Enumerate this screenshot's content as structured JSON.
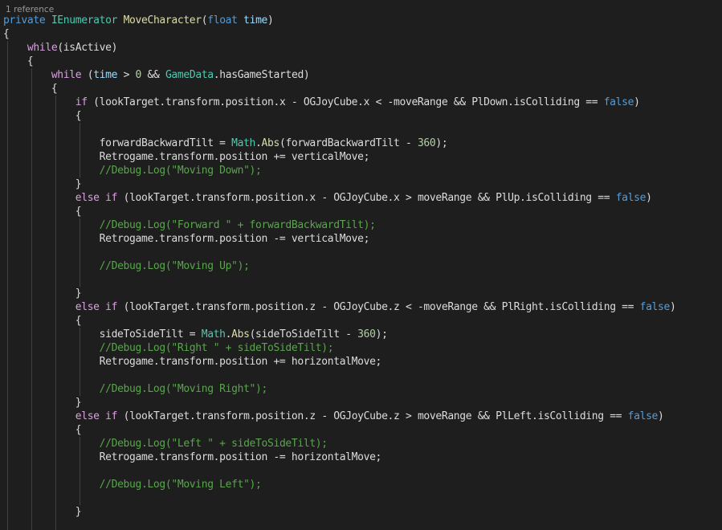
{
  "codelens": {
    "references": "1 reference"
  },
  "colors": {
    "background": "#1e1e1e",
    "keyword": "#569cd6",
    "control": "#d8a0df",
    "type": "#4ec9b0",
    "method": "#dcdcaa",
    "comment": "#57a64a",
    "number": "#b5cea8",
    "plain": "#dcdcdc",
    "parameter": "#9cdcfe"
  },
  "lines": [
    [
      {
        "c": "kw",
        "t": "private"
      },
      {
        "c": "id",
        "t": " "
      },
      {
        "c": "ty",
        "t": "IEnumerator"
      },
      {
        "c": "id",
        "t": " "
      },
      {
        "c": "mth",
        "t": "MoveCharacter"
      },
      {
        "c": "id",
        "t": "("
      },
      {
        "c": "kw",
        "t": "float"
      },
      {
        "c": "id",
        "t": " "
      },
      {
        "c": "pr",
        "t": "time"
      },
      {
        "c": "id",
        "t": ")"
      }
    ],
    [
      {
        "c": "id",
        "t": "{"
      }
    ],
    [
      {
        "c": "id",
        "t": "    "
      },
      {
        "c": "ctl",
        "t": "while"
      },
      {
        "c": "id",
        "t": "(isActive)"
      }
    ],
    [
      {
        "c": "id",
        "t": "    {"
      }
    ],
    [
      {
        "c": "id",
        "t": "        "
      },
      {
        "c": "ctl",
        "t": "while"
      },
      {
        "c": "id",
        "t": " ("
      },
      {
        "c": "pr",
        "t": "time"
      },
      {
        "c": "id",
        "t": " > "
      },
      {
        "c": "num",
        "t": "0"
      },
      {
        "c": "id",
        "t": " && "
      },
      {
        "c": "ty",
        "t": "GameData"
      },
      {
        "c": "id",
        "t": ".hasGameStarted)"
      }
    ],
    [
      {
        "c": "id",
        "t": "        {"
      }
    ],
    [
      {
        "c": "id",
        "t": "            "
      },
      {
        "c": "ctl",
        "t": "if"
      },
      {
        "c": "id",
        "t": " (lookTarget.transform.position.x - OGJoyCube.x < -moveRange && PlDown.isColliding == "
      },
      {
        "c": "kw",
        "t": "false"
      },
      {
        "c": "id",
        "t": ")"
      }
    ],
    [
      {
        "c": "id",
        "t": "            {"
      }
    ],
    [
      {
        "c": "id",
        "t": ""
      }
    ],
    [
      {
        "c": "id",
        "t": "                forwardBackwardTilt = "
      },
      {
        "c": "ty",
        "t": "Math"
      },
      {
        "c": "id",
        "t": "."
      },
      {
        "c": "mth",
        "t": "Abs"
      },
      {
        "c": "id",
        "t": "(forwardBackwardTilt - "
      },
      {
        "c": "num",
        "t": "360"
      },
      {
        "c": "id",
        "t": ");"
      }
    ],
    [
      {
        "c": "id",
        "t": "                Retrogame.transform.position += verticalMove;"
      }
    ],
    [
      {
        "c": "id",
        "t": "                "
      },
      {
        "c": "cm",
        "t": "//Debug.Log(\"Moving Down\");"
      }
    ],
    [
      {
        "c": "id",
        "t": "            }"
      }
    ],
    [
      {
        "c": "id",
        "t": "            "
      },
      {
        "c": "ctl",
        "t": "else"
      },
      {
        "c": "id",
        "t": " "
      },
      {
        "c": "ctl",
        "t": "if"
      },
      {
        "c": "id",
        "t": " (lookTarget.transform.position.x - OGJoyCube.x > moveRange && PlUp.isColliding == "
      },
      {
        "c": "kw",
        "t": "false"
      },
      {
        "c": "id",
        "t": ")"
      }
    ],
    [
      {
        "c": "id",
        "t": "            {"
      }
    ],
    [
      {
        "c": "id",
        "t": "                "
      },
      {
        "c": "cm",
        "t": "//Debug.Log(\"Forward \" + forwardBackwardTilt);"
      }
    ],
    [
      {
        "c": "id",
        "t": "                Retrogame.transform.position -= verticalMove;"
      }
    ],
    [
      {
        "c": "id",
        "t": ""
      }
    ],
    [
      {
        "c": "id",
        "t": "                "
      },
      {
        "c": "cm",
        "t": "//Debug.Log(\"Moving Up\");"
      }
    ],
    [
      {
        "c": "id",
        "t": ""
      }
    ],
    [
      {
        "c": "id",
        "t": "            }"
      }
    ],
    [
      {
        "c": "id",
        "t": "            "
      },
      {
        "c": "ctl",
        "t": "else"
      },
      {
        "c": "id",
        "t": " "
      },
      {
        "c": "ctl",
        "t": "if"
      },
      {
        "c": "id",
        "t": " (lookTarget.transform.position.z - OGJoyCube.z < -moveRange && PlRight.isColliding == "
      },
      {
        "c": "kw",
        "t": "false"
      },
      {
        "c": "id",
        "t": ")"
      }
    ],
    [
      {
        "c": "id",
        "t": "            {"
      }
    ],
    [
      {
        "c": "id",
        "t": "                sideToSideTilt = "
      },
      {
        "c": "ty",
        "t": "Math"
      },
      {
        "c": "id",
        "t": "."
      },
      {
        "c": "mth",
        "t": "Abs"
      },
      {
        "c": "id",
        "t": "(sideToSideTilt - "
      },
      {
        "c": "num",
        "t": "360"
      },
      {
        "c": "id",
        "t": ");"
      }
    ],
    [
      {
        "c": "id",
        "t": "                "
      },
      {
        "c": "cm",
        "t": "//Debug.Log(\"Right \" + sideToSideTilt);"
      }
    ],
    [
      {
        "c": "id",
        "t": "                Retrogame.transform.position += horizontalMove;"
      }
    ],
    [
      {
        "c": "id",
        "t": ""
      }
    ],
    [
      {
        "c": "id",
        "t": "                "
      },
      {
        "c": "cm",
        "t": "//Debug.Log(\"Moving Right\");"
      }
    ],
    [
      {
        "c": "id",
        "t": "            }"
      }
    ],
    [
      {
        "c": "id",
        "t": "            "
      },
      {
        "c": "ctl",
        "t": "else"
      },
      {
        "c": "id",
        "t": " "
      },
      {
        "c": "ctl",
        "t": "if"
      },
      {
        "c": "id",
        "t": " (lookTarget.transform.position.z - OGJoyCube.z > moveRange && PlLeft.isColliding == "
      },
      {
        "c": "kw",
        "t": "false"
      },
      {
        "c": "id",
        "t": ")"
      }
    ],
    [
      {
        "c": "id",
        "t": "            {"
      }
    ],
    [
      {
        "c": "id",
        "t": "                "
      },
      {
        "c": "cm",
        "t": "//Debug.Log(\"Left \" + sideToSideTilt);"
      }
    ],
    [
      {
        "c": "id",
        "t": "                Retrogame.transform.position -= horizontalMove;"
      }
    ],
    [
      {
        "c": "id",
        "t": ""
      }
    ],
    [
      {
        "c": "id",
        "t": "                "
      },
      {
        "c": "cm",
        "t": "//Debug.Log(\"Moving Left\");"
      }
    ],
    [
      {
        "c": "id",
        "t": ""
      }
    ],
    [
      {
        "c": "id",
        "t": "            }"
      }
    ],
    [
      {
        "c": "id",
        "t": ""
      }
    ]
  ]
}
